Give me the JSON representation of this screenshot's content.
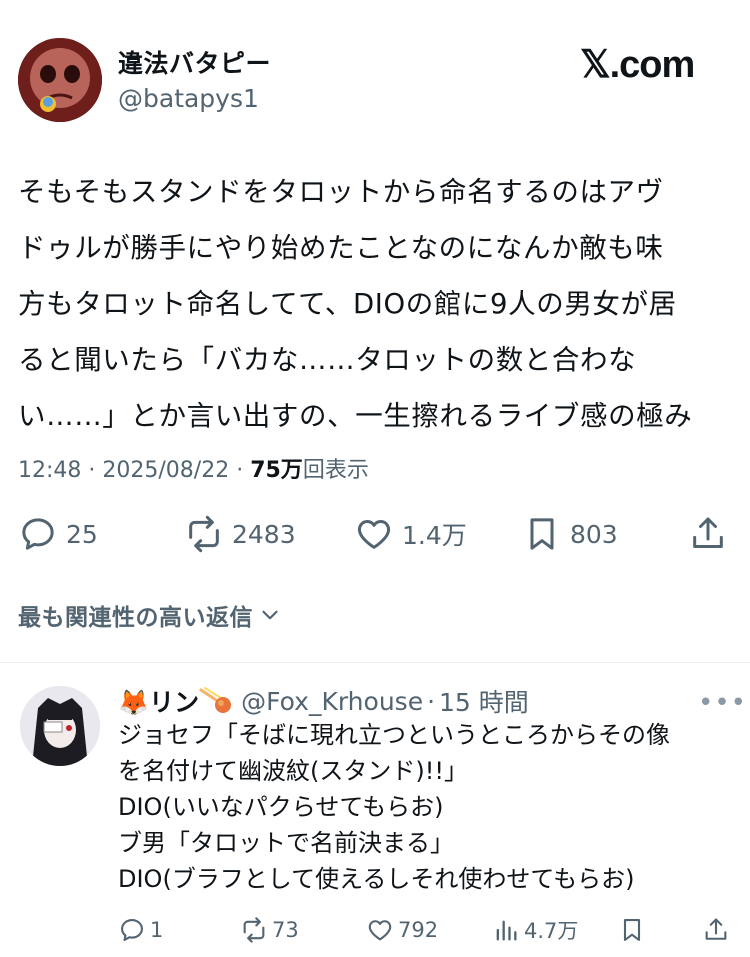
{
  "tweet": {
    "display_name": "違法バタピー",
    "handle": "@batapys1",
    "brand": "𝕏.com",
    "text": "そもそもスタンドをタロットから命名するのはアヴ\nドゥルが勝手にやり始めたことなのになんか敵も味\n方もタロット命名してて、DIOの館に9人の男女が居\nると聞いたら「バカな……タロットの数と合わな\nい……」とか言い出すの、一生擦れるライブ感の極み",
    "time": "12:48",
    "date": "2025/08/22",
    "views_count": "75万",
    "views_label": "回表示",
    "replies": "25",
    "reposts": "2483",
    "likes": "1.4万",
    "bookmarks": "803"
  },
  "related_label": "最も関連性の高い返信",
  "reply": {
    "display_name": "🦊リン",
    "handle": "@Fox_Krhouse",
    "time": "15 時間",
    "more": "•••",
    "text": "ジョセフ「そばに現れ立つというところからその像\nを名付けて幽波紋(スタンド)!!」\nDIO(いいなパクらせてもらお)\nブ男「タロットで名前決まる」\nDIO(ブラフとして使えるしそれ使わせてもらお)",
    "replies": "1",
    "reposts": "73",
    "likes": "792",
    "views": "4.7万"
  },
  "colors": {
    "text": "#0f1419",
    "secondary": "#536471",
    "divider": "#e6ecf0"
  }
}
